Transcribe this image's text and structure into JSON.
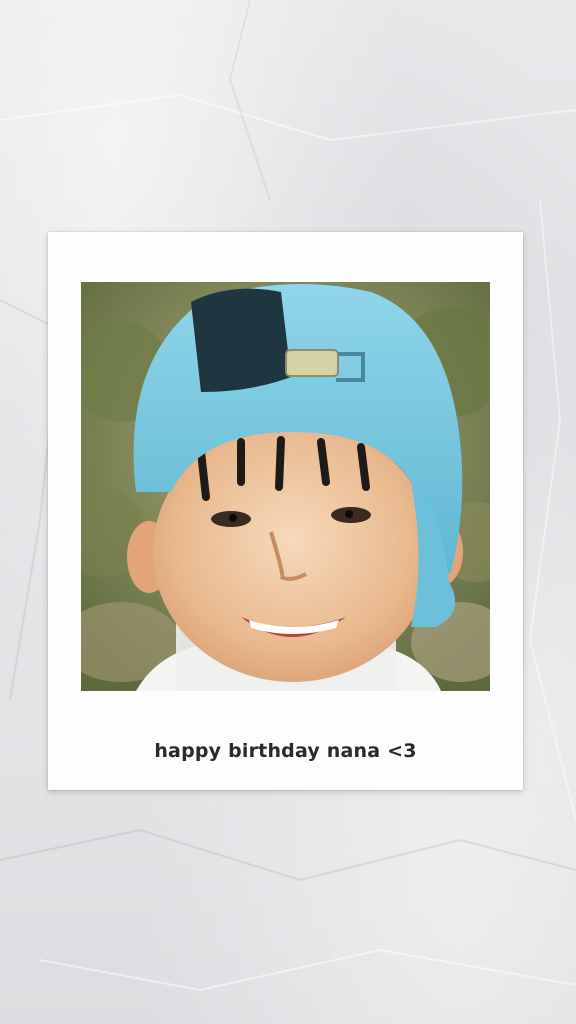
{
  "caption": "happy birthday nana <3",
  "photo": {
    "subject": "smiling child wearing a backwards light-blue cap outdoors"
  },
  "colors": {
    "background": "#e3e4e6",
    "frame": "#fdfdfd",
    "caption_text": "#2a2a2a",
    "cap": "#7ec9df"
  }
}
